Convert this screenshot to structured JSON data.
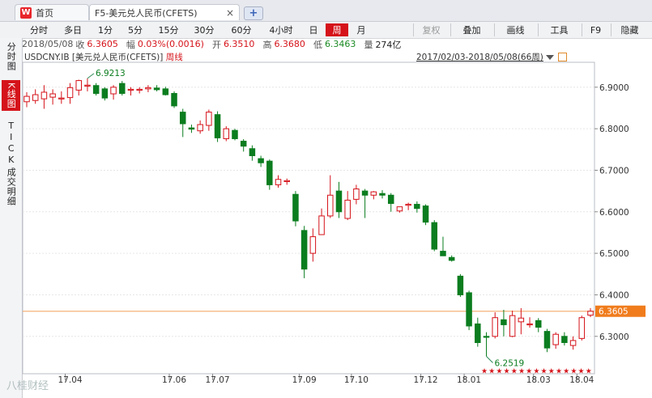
{
  "tabs": {
    "home_label": "首页",
    "active_label": "F5-美元兑人民币(CFETS)",
    "close_glyph": "×",
    "add_glyph": "+"
  },
  "toolbar": {
    "periods": [
      "分时",
      "多日",
      "1分",
      "5分",
      "15分",
      "30分",
      "60分",
      "4小时",
      "日",
      "周",
      "月"
    ],
    "active_period": "周",
    "restore_label": "复权",
    "overlay_label": "叠加",
    "drawline_label": "画线",
    "tools_label": "工具",
    "f9_label": "F9",
    "hide_label": "隐藏"
  },
  "info": {
    "date": "2018/05/08",
    "close_label": "收",
    "close": "6.3605",
    "change_label": "幅",
    "change": "0.03%(0.0016)",
    "open_label": "开",
    "open": "6.3510",
    "high_label": "高",
    "high": "6.3680",
    "low_label": "低",
    "low": "6.3463",
    "volume_label": "量",
    "volume": "274亿"
  },
  "sidebar": {
    "items": [
      "分时图",
      "K线图",
      "TICK",
      "成交明细"
    ],
    "active": "K线图"
  },
  "chart_title": {
    "code": "USDCNY.IB",
    "name": "[美元兑人民币(CFETS)]",
    "period": "周线"
  },
  "range_label": "2017/02/03-2018/05/08(66周)",
  "watermark": "八桂财经",
  "colors": {
    "up": "#d5131a",
    "down": "#0b7d1f",
    "current_line": "#f4b27a",
    "current_tag": "#f07c1c",
    "grid": "#e6e6e6"
  },
  "chart_data": {
    "type": "candlestick",
    "title": "USDCNY.IB [美元兑人民币(CFETS)] 周线",
    "ylim": [
      6.21,
      6.96
    ],
    "y_ticks": [
      "6.9000",
      "6.8000",
      "6.7000",
      "6.6000",
      "6.5000",
      "6.4000",
      "6.3000"
    ],
    "x_ticks": [
      "17.04",
      "17.06",
      "17.07",
      "17.09",
      "17.10",
      "17.12",
      "18.01",
      "18.03",
      "18.04"
    ],
    "current_price": "6.3605",
    "annotations": [
      {
        "label": "6.9213",
        "value": 6.9213
      },
      {
        "label": "6.2519",
        "value": 6.2519
      }
    ],
    "candles": [
      {
        "o": 6.865,
        "h": 6.888,
        "l": 6.852,
        "c": 6.878
      },
      {
        "o": 6.868,
        "h": 6.895,
        "l": 6.86,
        "c": 6.882
      },
      {
        "o": 6.872,
        "h": 6.905,
        "l": 6.848,
        "c": 6.888
      },
      {
        "o": 6.876,
        "h": 6.895,
        "l": 6.858,
        "c": 6.884
      },
      {
        "o": 6.872,
        "h": 6.89,
        "l": 6.86,
        "c": 6.874
      },
      {
        "o": 6.875,
        "h": 6.91,
        "l": 6.86,
        "c": 6.899
      },
      {
        "o": 6.893,
        "h": 6.918,
        "l": 6.88,
        "c": 6.916
      },
      {
        "o": 6.905,
        "h": 6.9213,
        "l": 6.89,
        "c": 6.905
      },
      {
        "o": 6.904,
        "h": 6.91,
        "l": 6.88,
        "c": 6.885
      },
      {
        "o": 6.896,
        "h": 6.9,
        "l": 6.868,
        "c": 6.874
      },
      {
        "o": 6.884,
        "h": 6.905,
        "l": 6.87,
        "c": 6.9
      },
      {
        "o": 6.909,
        "h": 6.915,
        "l": 6.88,
        "c": 6.885
      },
      {
        "o": 6.893,
        "h": 6.9,
        "l": 6.88,
        "c": 6.895
      },
      {
        "o": 6.893,
        "h": 6.9,
        "l": 6.885,
        "c": 6.895
      },
      {
        "o": 6.896,
        "h": 6.905,
        "l": 6.888,
        "c": 6.899
      },
      {
        "o": 6.898,
        "h": 6.905,
        "l": 6.89,
        "c": 6.894
      },
      {
        "o": 6.896,
        "h": 6.901,
        "l": 6.88,
        "c": 6.882
      },
      {
        "o": 6.885,
        "h": 6.89,
        "l": 6.85,
        "c": 6.855
      },
      {
        "o": 6.84,
        "h": 6.848,
        "l": 6.78,
        "c": 6.812
      },
      {
        "o": 6.802,
        "h": 6.81,
        "l": 6.79,
        "c": 6.799
      },
      {
        "o": 6.795,
        "h": 6.82,
        "l": 6.788,
        "c": 6.81
      },
      {
        "o": 6.808,
        "h": 6.846,
        "l": 6.795,
        "c": 6.84
      },
      {
        "o": 6.834,
        "h": 6.842,
        "l": 6.768,
        "c": 6.778
      },
      {
        "o": 6.776,
        "h": 6.806,
        "l": 6.77,
        "c": 6.8
      },
      {
        "o": 6.796,
        "h": 6.8,
        "l": 6.772,
        "c": 6.776
      },
      {
        "o": 6.77,
        "h": 6.775,
        "l": 6.745,
        "c": 6.758
      },
      {
        "o": 6.752,
        "h": 6.76,
        "l": 6.723,
        "c": 6.735
      },
      {
        "o": 6.728,
        "h": 6.735,
        "l": 6.708,
        "c": 6.718
      },
      {
        "o": 6.722,
        "h": 6.726,
        "l": 6.653,
        "c": 6.665
      },
      {
        "o": 6.665,
        "h": 6.688,
        "l": 6.658,
        "c": 6.678
      },
      {
        "o": 6.675,
        "h": 6.68,
        "l": 6.665,
        "c": 6.675
      },
      {
        "o": 6.642,
        "h": 6.65,
        "l": 6.565,
        "c": 6.578
      },
      {
        "o": 6.555,
        "h": 6.566,
        "l": 6.44,
        "c": 6.462
      },
      {
        "o": 6.5,
        "h": 6.56,
        "l": 6.48,
        "c": 6.54
      },
      {
        "o": 6.545,
        "h": 6.608,
        "l": 6.545,
        "c": 6.59
      },
      {
        "o": 6.59,
        "h": 6.688,
        "l": 6.585,
        "c": 6.64
      },
      {
        "o": 6.65,
        "h": 6.672,
        "l": 6.585,
        "c": 6.6
      },
      {
        "o": 6.584,
        "h": 6.65,
        "l": 6.58,
        "c": 6.628
      },
      {
        "o": 6.63,
        "h": 6.665,
        "l": 6.618,
        "c": 6.655
      },
      {
        "o": 6.65,
        "h": 6.655,
        "l": 6.585,
        "c": 6.64
      },
      {
        "o": 6.64,
        "h": 6.65,
        "l": 6.63,
        "c": 6.648
      },
      {
        "o": 6.644,
        "h": 6.652,
        "l": 6.632,
        "c": 6.64
      },
      {
        "o": 6.64,
        "h": 6.645,
        "l": 6.6,
        "c": 6.62
      },
      {
        "o": 6.602,
        "h": 6.612,
        "l": 6.598,
        "c": 6.612
      },
      {
        "o": 6.616,
        "h": 6.622,
        "l": 6.604,
        "c": 6.618
      },
      {
        "o": 6.618,
        "h": 6.625,
        "l": 6.598,
        "c": 6.608
      },
      {
        "o": 6.614,
        "h": 6.618,
        "l": 6.568,
        "c": 6.575
      },
      {
        "o": 6.574,
        "h": 6.58,
        "l": 6.505,
        "c": 6.51
      },
      {
        "o": 6.505,
        "h": 6.54,
        "l": 6.494,
        "c": 6.494
      },
      {
        "o": 6.49,
        "h": 6.495,
        "l": 6.48,
        "c": 6.483
      },
      {
        "o": 6.445,
        "h": 6.45,
        "l": 6.395,
        "c": 6.4
      },
      {
        "o": 6.405,
        "h": 6.41,
        "l": 6.315,
        "c": 6.325
      },
      {
        "o": 6.33,
        "h": 6.345,
        "l": 6.275,
        "c": 6.285
      },
      {
        "o": 6.3,
        "h": 6.31,
        "l": 6.2519,
        "c": 6.298
      },
      {
        "o": 6.3,
        "h": 6.358,
        "l": 6.295,
        "c": 6.345
      },
      {
        "o": 6.34,
        "h": 6.364,
        "l": 6.3,
        "c": 6.328
      },
      {
        "o": 6.3,
        "h": 6.362,
        "l": 6.298,
        "c": 6.35
      },
      {
        "o": 6.335,
        "h": 6.368,
        "l": 6.305,
        "c": 6.344
      },
      {
        "o": 6.33,
        "h": 6.346,
        "l": 6.321,
        "c": 6.33
      },
      {
        "o": 6.338,
        "h": 6.344,
        "l": 6.31,
        "c": 6.322
      },
      {
        "o": 6.312,
        "h": 6.318,
        "l": 6.262,
        "c": 6.272
      },
      {
        "o": 6.28,
        "h": 6.31,
        "l": 6.27,
        "c": 6.305
      },
      {
        "o": 6.3,
        "h": 6.31,
        "l": 6.278,
        "c": 6.285
      },
      {
        "o": 6.278,
        "h": 6.3,
        "l": 6.268,
        "c": 6.29
      },
      {
        "o": 6.295,
        "h": 6.35,
        "l": 6.29,
        "c": 6.345
      },
      {
        "o": 6.351,
        "h": 6.368,
        "l": 6.3463,
        "c": 6.3605
      }
    ]
  }
}
